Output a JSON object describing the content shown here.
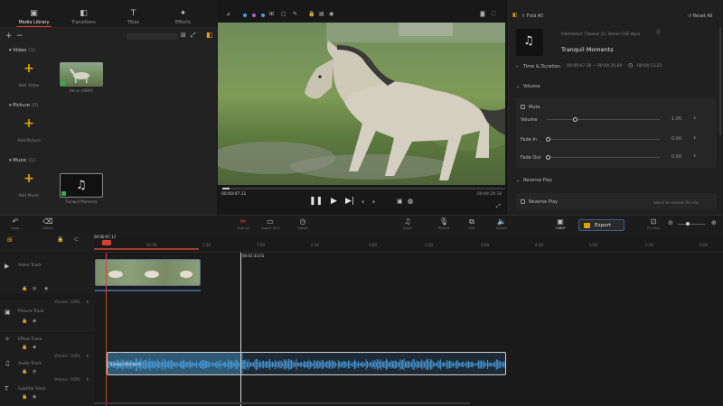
{
  "tabs": [
    {
      "label": "Media Library",
      "icon": "media-library-icon",
      "glyph": "▣"
    },
    {
      "label": "Transitions",
      "icon": "transitions-icon",
      "glyph": "◧"
    },
    {
      "label": "Titles",
      "icon": "titles-icon",
      "glyph": "T"
    },
    {
      "label": "Effects",
      "icon": "effects-icon",
      "glyph": "✦"
    }
  ],
  "library": {
    "sections": [
      {
        "label": "Video",
        "count": "(1)",
        "add_label": "Add Video",
        "item_name": "Horse (480P)"
      },
      {
        "label": "Picture",
        "count": "(0)",
        "add_label": "Add Picture"
      },
      {
        "label": "Music",
        "count": "(1)",
        "add_label": "Add Music",
        "item_name": "Tranquil Moments"
      }
    ]
  },
  "preview": {
    "current_time": "00:00:07.11",
    "total_time": "00:04:20.16",
    "scrubber_progress": 0.027
  },
  "props": {
    "header_left": "Fold All",
    "header_right": "Reset All",
    "media_info": "Information: Channel (2), Stereo (192 kbps)",
    "title": "Tranquil Moments",
    "time_duration_label": "Time & Duration",
    "time_range": "00:00:07.36 ~ 00:04:20.69",
    "duration": "00:04:13.23",
    "volume_section": "Volume",
    "mute_label": "Mute",
    "volume_label": "Volume",
    "volume_value": "1.00",
    "volume_level": 0.25,
    "fade_in_label": "Fade In",
    "fade_in_value": "0.00",
    "fade_out_label": "Fade Out",
    "fade_out_value": "0.00",
    "reverse_section": "Reverse Play",
    "reverse_checkbox": "Reverse Play",
    "reverse_hint": "Select to reverse the clip"
  },
  "toolbar": {
    "left": [
      {
        "label": "Undo",
        "icon": "undo-icon",
        "glyph": "↶"
      },
      {
        "label": "Delete",
        "icon": "trash-icon",
        "glyph": "🗑"
      }
    ],
    "middle": [
      {
        "label": "Split All",
        "icon": "split-icon",
        "glyph": "✂"
      },
      {
        "label": "Aspect 16:9",
        "icon": "aspect-icon",
        "glyph": "▭"
      },
      {
        "label": "Speed",
        "icon": "speed-icon",
        "glyph": "◷"
      },
      {
        "label": "Music",
        "icon": "music-icon",
        "glyph": "♫"
      },
      {
        "label": "Record",
        "icon": "microphone-icon",
        "glyph": "🎙"
      },
      {
        "label": "Edit",
        "icon": "edit-icon",
        "glyph": "⧉"
      },
      {
        "label": "Detach",
        "icon": "audio-icon",
        "glyph": "🔈"
      }
    ],
    "resolution": "1080P",
    "export_label": "Export",
    "fit_label": "Fit View"
  },
  "timeline": {
    "ruler": [
      "00:00:07.11",
      "01:00",
      "1:30",
      "1:60",
      "2:30",
      "3:00",
      "3:30",
      "4:00",
      "4:30",
      "5:00",
      "5:30",
      "6:00"
    ],
    "hover_time": "00:01:33.01",
    "tracks": [
      {
        "label": "Video Track",
        "icon": "video-track-icon",
        "glyph": "▶"
      },
      {
        "label": "Picture Track",
        "icon": "picture-track-icon",
        "glyph": "▣"
      },
      {
        "label": "Effect Track",
        "icon": "effect-track-icon",
        "glyph": "✧"
      },
      {
        "label": "Audio Track",
        "icon": "audio-track-icon",
        "glyph": "♫"
      },
      {
        "label": "Subtitle Track",
        "icon": "subtitle-track-icon",
        "glyph": "T"
      }
    ],
    "volume_readout": "Volume: 100%",
    "audio_clip_name": "Tranquil Moments",
    "track_area_label": "Timeline tracks"
  },
  "colors": {
    "accent": "#e0462f",
    "export": "#e0a400",
    "audio_wave": "#4a9fe0"
  }
}
